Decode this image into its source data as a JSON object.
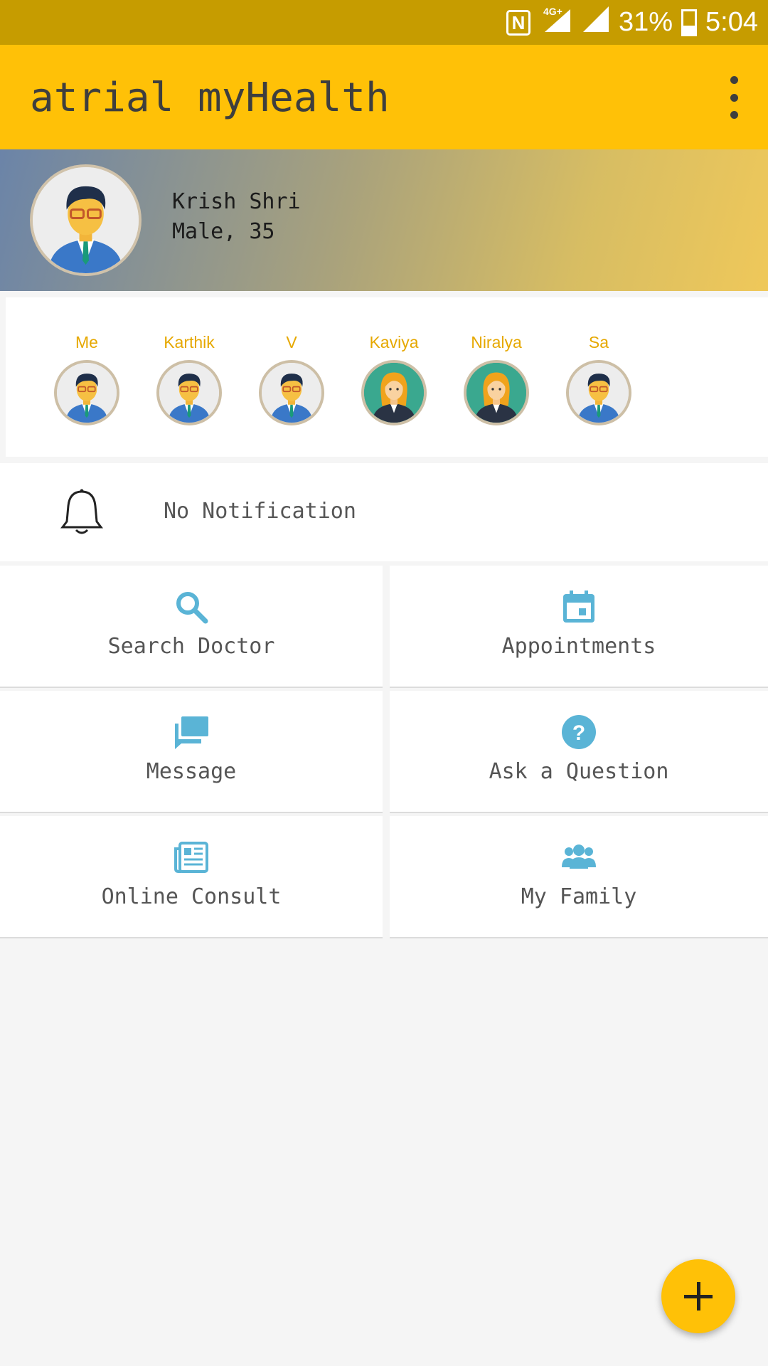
{
  "status_bar": {
    "network": "4G+",
    "battery": "31%",
    "time": "5:04"
  },
  "app_bar": {
    "title": "atrial myHealth"
  },
  "profile": {
    "name": "Krish Shri",
    "info": "Male, 35"
  },
  "family_members": [
    {
      "name": "Me",
      "avatar": "male-avatar"
    },
    {
      "name": "Karthik",
      "avatar": "male-avatar"
    },
    {
      "name": "V",
      "avatar": "male-avatar"
    },
    {
      "name": "Kaviya",
      "avatar": "female-avatar"
    },
    {
      "name": "Niralya",
      "avatar": "female-avatar"
    },
    {
      "name": "Sa",
      "avatar": "male-avatar"
    }
  ],
  "notification": {
    "text": "No Notification",
    "icon": "bell-icon"
  },
  "tiles": [
    {
      "label": "Search Doctor",
      "icon": "search-icon"
    },
    {
      "label": "Appointments",
      "icon": "calendar-icon"
    },
    {
      "label": "Message",
      "icon": "message-icon"
    },
    {
      "label": "Ask a Question",
      "icon": "question-icon"
    },
    {
      "label": "Online Consult",
      "icon": "newspaper-icon"
    },
    {
      "label": "My Family",
      "icon": "family-icon"
    }
  ],
  "colors": {
    "accent": "#ffc107",
    "icon": "#5ab4d6",
    "status_bar": "#c69c00"
  }
}
